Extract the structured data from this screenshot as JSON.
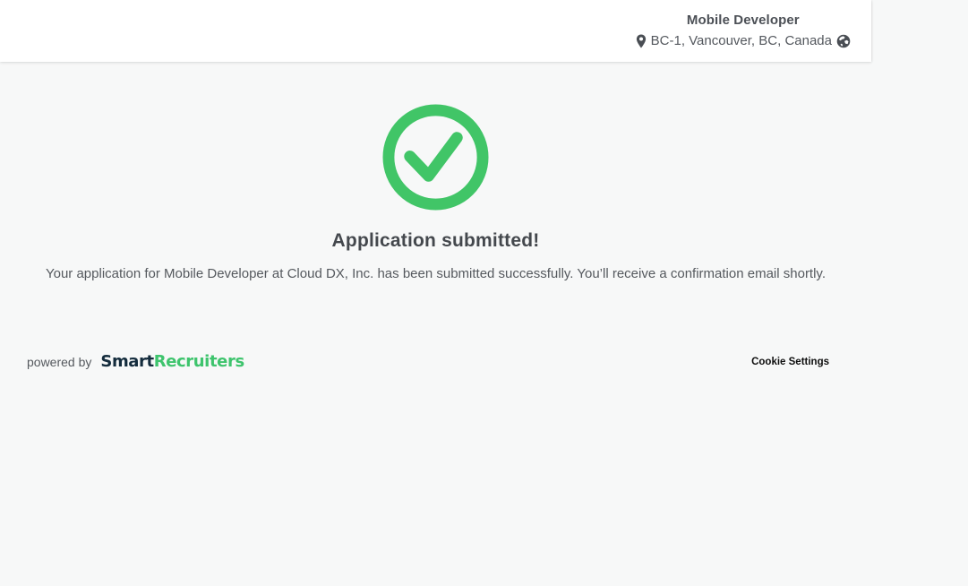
{
  "header": {
    "job_title": "Mobile Developer",
    "location": "BC-1, Vancouver, BC, Canada"
  },
  "main": {
    "heading": "Application submitted!",
    "message": "Your application for Mobile Developer at Cloud DX, Inc. has been submitted successfully. You’ll receive a confirmation email shortly."
  },
  "footer": {
    "powered_by_label": "powered by",
    "brand_first": "Smart",
    "brand_second": "Recruiters",
    "cookie_settings_label": "Cookie Settings"
  },
  "icons": {
    "location_pin": "location-pin-icon",
    "globe": "globe-icon",
    "success_check": "check-circle-icon"
  },
  "colors": {
    "page_background": "#f7f8f8",
    "header_background": "#ffffff",
    "success_green": "#41c567",
    "brand_navy": "#142c3d",
    "brand_green": "#3ec46d",
    "title_text": "#4c5056",
    "body_text": "#55595e",
    "heading_text": "#44484d"
  }
}
